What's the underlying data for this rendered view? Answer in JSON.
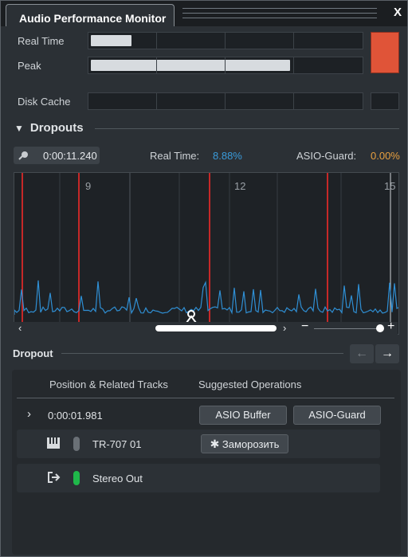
{
  "window": {
    "title": "Audio Performance Monitor",
    "close_label": "X"
  },
  "meters": {
    "real_time": {
      "label": "Real Time",
      "level": 0.15
    },
    "peak": {
      "label": "Peak",
      "level": 0.74
    },
    "disk_cache": {
      "label": "Disk Cache",
      "level": 0.0
    },
    "overload_indicator_color": "#e05438"
  },
  "dropouts": {
    "section_title": "Dropouts",
    "collapse_icon": "triangle-down-icon",
    "time_value": "0:00:11.240",
    "real_time_label": "Real Time:",
    "real_time_value": "8.88%",
    "asio_guard_label": "ASIO-Guard:",
    "asio_guard_value": "0.00%",
    "real_time_color": "#3a9ad9",
    "asio_guard_color": "#e8a040",
    "graph": {
      "ruler_labels": [
        "9",
        "12",
        "15"
      ],
      "line_color": "#2f8fd4",
      "dropout_marker_color": "#c62828"
    },
    "zoom_minus": "−",
    "zoom_plus": "+"
  },
  "dropout_detail": {
    "title": "Dropout",
    "prev_icon": "arrow-left-icon",
    "next_icon": "arrow-right-icon",
    "columns": [
      "Position & Related Tracks",
      "Suggested Operations"
    ],
    "entry": {
      "expand_icon": "chevron-right-icon",
      "position": "0:00:01.981",
      "operations": [
        "ASIO Buffer",
        "ASIO-Guard"
      ]
    },
    "tracks": [
      {
        "icon": "keyboard-icon",
        "name": "TR-707 01",
        "indicator_color": "#6a7076",
        "action_label": "Заморозить",
        "action_icon": "snowflake-icon"
      },
      {
        "icon": "output-icon",
        "name": "Stereo Out",
        "indicator_color": "#1fb84a"
      }
    ]
  }
}
